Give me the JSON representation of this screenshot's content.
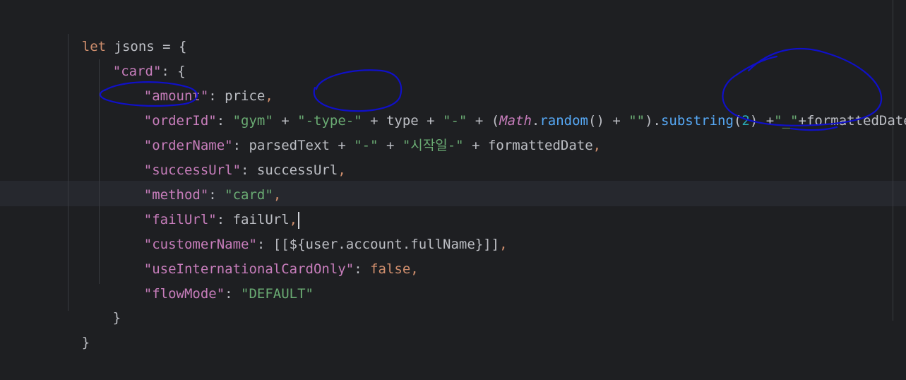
{
  "editor": {
    "line1": {
      "kw": "let",
      "name": " jsons = {"
    },
    "line2": {
      "key": "\"card\"",
      "rest": ": {"
    },
    "line3": {
      "key": "\"amount\"",
      "rest": ": price",
      "comma": ","
    },
    "line4": {
      "key": "\"orderId\"",
      "colon": ": ",
      "s1": "\"gym\"",
      "p1": " + ",
      "s2": "\"-type-\"",
      "p2": " + type + ",
      "s3": "\"-\"",
      "p3": " + (",
      "cls": "Math",
      "dot": ".",
      "fn1": "random",
      "p4": "() + ",
      "s4": "\"\"",
      "p5": ").",
      "fn2": "substring",
      "p6": "(",
      "num": "2",
      "p7": ") +",
      "s5": "\"_\"",
      "p8": "+formattedDate",
      "comma": ","
    },
    "line5": {
      "key": "\"orderName\"",
      "p1": ": parsedText + ",
      "s1": "\"-\"",
      "p2": " + ",
      "s2": "\"시작일-\"",
      "p3": " + formattedDate",
      "comma": ","
    },
    "line6": {
      "key": "\"successUrl\"",
      "rest": ": successUrl",
      "comma": ","
    },
    "line7": {
      "key": "\"method\"",
      "colon": ": ",
      "val": "\"card\"",
      "comma": ","
    },
    "line8": {
      "key": "\"failUrl\"",
      "rest": ": failUrl",
      "comma": ","
    },
    "line9": {
      "key": "\"customerName\"",
      "rest": ": [[${user.account.fullName}]]",
      "comma": ","
    },
    "line10": {
      "key": "\"useInternationalCardOnly\"",
      "colon": ": ",
      "kw": "false",
      "comma": ","
    },
    "line11": {
      "key": "\"flowMode\"",
      "colon": ": ",
      "val": "\"DEFAULT\""
    },
    "line12": {
      "text": "}"
    },
    "line13": {
      "text": "}"
    }
  },
  "colors": {
    "background": "#1e1f22",
    "keyword": "#cf8e6d",
    "string": "#6aab73",
    "property": "#c77dbb",
    "function": "#56a8f5",
    "number": "#2aacb8",
    "annotation": "#1010c8"
  }
}
